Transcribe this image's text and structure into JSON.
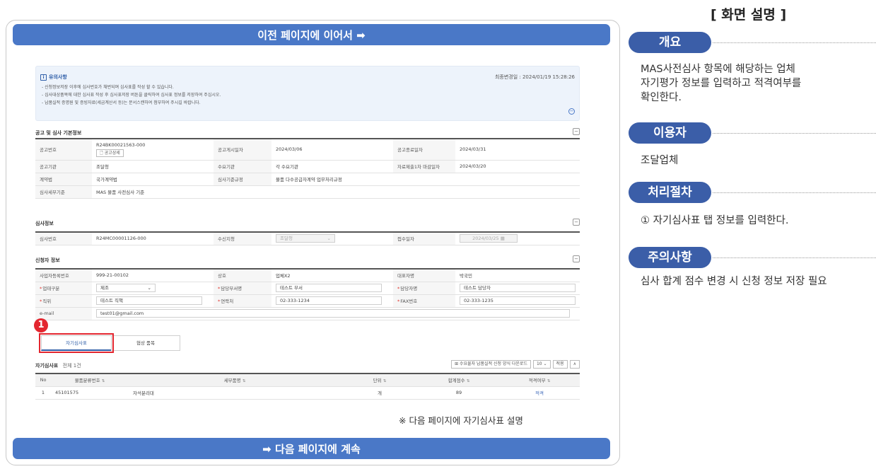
{
  "banners": {
    "top": "이전 페이지에 이어서 ➡",
    "bottom": "➡ 다음 페이지에 계속"
  },
  "notice": {
    "title": "유의사항",
    "updated": "최종변경일 : 2024/01/19 15:28:26",
    "lines": [
      "- 신청정보저장 이후에 심사번호가 채번되며 심사표를 작성 할 수 있습니다.",
      "- 심사대상품목에 대한 심사표 작성 후 심사표저장 버튼을 클릭하여 심사표 정보를 저장하여 주십시오.",
      "- 납품실적 증명원 및 증빙자료(세금계산서 등)는 문서스캔하여 첨부하여 주시길 바랍니다."
    ]
  },
  "announcement": {
    "title": "공고 및 심사 기본정보",
    "no_label": "공고번호",
    "no_value": "R24BK00021563-000",
    "detail_btn": "공고상세",
    "post_label": "공고게시일자",
    "post_value": "2024/03/06",
    "end_label": "공고종료일자",
    "end_value": "2024/03/31",
    "agency_label": "공고기관",
    "agency_value": "조달청",
    "demand_label": "수요기관",
    "demand_value": "각 수요기관",
    "deadline_label": "자료제출1차 마감일자",
    "deadline_value": "2024/03/20",
    "contract_label": "계약법",
    "contract_value": "국가계약법",
    "rule_label": "심사기준규정",
    "rule_value": "물품 다수공급자계약 업무처리규정",
    "criteria_label": "심사세부기준",
    "criteria_value": "MAS 물품 사전심사 기준"
  },
  "review": {
    "title": "심사정보",
    "no_label": "심사번호",
    "no_value": "R24MC00001126-000",
    "office_label": "수신지청",
    "office_value": "조달청",
    "recv_label": "접수일자",
    "recv_value": "2024/03/25"
  },
  "applicant": {
    "title": "신청자 정보",
    "biz_label": "사업자등록번호",
    "biz_value": "999-21-00102",
    "name_label": "상호",
    "name_value": "업체X2",
    "ceo_label": "대표자명",
    "ceo_value": "박국민",
    "type_label": "업태구분",
    "type_value": "제조",
    "dept_label": "담당부서명",
    "dept_value": "테스트 부서",
    "mgr_label": "담당자명",
    "mgr_value": "테스트 담당자",
    "pos_label": "직위",
    "pos_value": "테스트 직책",
    "tel_label": "연락처",
    "tel_value": "02-333-1234",
    "fax_label": "FAX번호",
    "fax_value": "02-333-1235",
    "email_label": "e-mail",
    "email_value": "test01@gmail.com"
  },
  "tabs": [
    "자기심사표",
    "협상 품목"
  ],
  "marker": "1",
  "self_review": {
    "title": "자기심사표",
    "count": "전체 1건",
    "download_btn": "수요물자 납품실적 신청 양식 다운로드",
    "page_size": "10",
    "apply_btn": "적용",
    "columns": [
      "No",
      "물품분류번호",
      "세부품명",
      "단위",
      "합계점수",
      "적격여부"
    ],
    "rows": [
      {
        "no": "1",
        "code": "45101575",
        "name": "자석분리대",
        "unit": "개",
        "score": "89",
        "result": "적격"
      }
    ]
  },
  "footnote": "※ 다음 페이지에 자기심사표 설명",
  "description": {
    "title": "[ 화면 설명 ]",
    "sections": [
      {
        "pill": "개요",
        "text": [
          "MAS사전심사 항목에 해당하는 업체",
          "자기평가 정보를 입력하고 적격여부를",
          "확인한다."
        ]
      },
      {
        "pill": "이용자",
        "text": [
          "조달업체"
        ]
      },
      {
        "pill": "처리절차",
        "text": [
          "① 자기심사표 탭 정보를 입력한다."
        ]
      },
      {
        "pill": "주의사항",
        "text": [
          "심사 합계 점수 변경 시 신청 정보 저장 필요"
        ]
      }
    ]
  },
  "colors": {
    "banner": "#4a78c7",
    "pill": "#3b5ea8",
    "highlight": "#e3262f"
  }
}
